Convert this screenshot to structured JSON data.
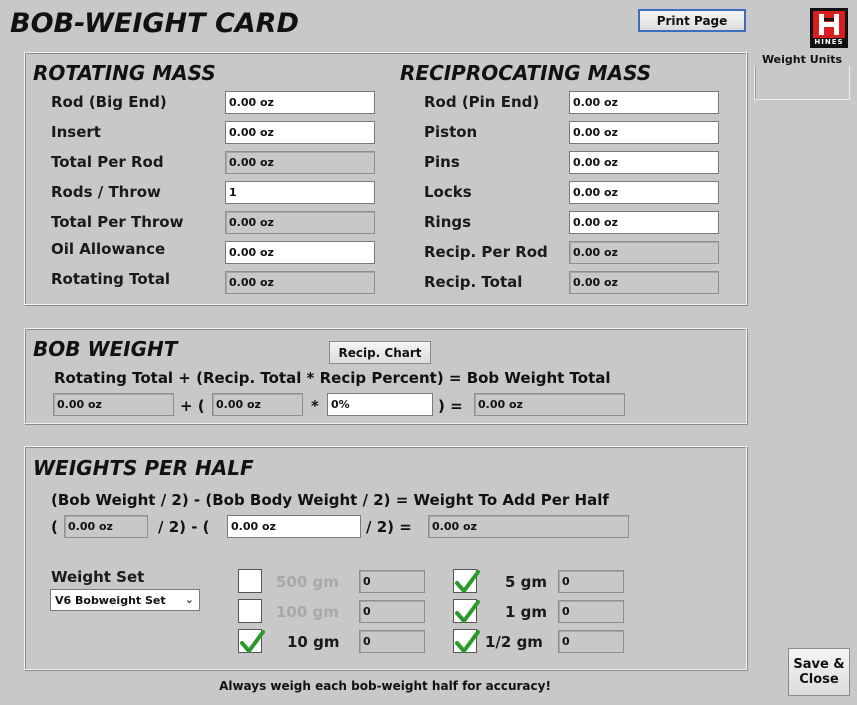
{
  "window": {
    "title": "BOB-WEIGHT CARD"
  },
  "toolbar": {
    "print_label": "Print Page"
  },
  "units": {
    "label": "Weight Units"
  },
  "logo": {
    "text": "HINES"
  },
  "rotating": {
    "title": "ROTATING MASS",
    "rows": [
      {
        "label": "Rod (Big End)",
        "value": "0.00 oz",
        "editable": true
      },
      {
        "label": "Insert",
        "value": "0.00 oz",
        "editable": true
      },
      {
        "label": "Total Per Rod",
        "value": "0.00 oz",
        "editable": false
      },
      {
        "label": "Rods / Throw",
        "value": "1",
        "editable": true
      },
      {
        "label": "Total Per Throw",
        "value": "0.00 oz",
        "editable": false
      },
      {
        "label": "Oil Allowance",
        "value": "0.00 oz",
        "editable": true
      },
      {
        "label": "Rotating Total",
        "value": "0.00 oz",
        "editable": false
      }
    ]
  },
  "reciprocating": {
    "title": "RECIPROCATING MASS",
    "rows": [
      {
        "label": "Rod (Pin End)",
        "value": "0.00 oz",
        "editable": true
      },
      {
        "label": "Piston",
        "value": "0.00 oz",
        "editable": true
      },
      {
        "label": "Pins",
        "value": "0.00 oz",
        "editable": true
      },
      {
        "label": "Locks",
        "value": "0.00 oz",
        "editable": true
      },
      {
        "label": "Rings",
        "value": "0.00 oz",
        "editable": true
      },
      {
        "label": "Recip. Per Rod",
        "value": "0.00 oz",
        "editable": false
      },
      {
        "label": "Recip. Total",
        "value": "0.00 oz",
        "editable": false
      }
    ]
  },
  "bob": {
    "title": "BOB WEIGHT",
    "chart_button": "Recip. Chart",
    "formula": "Rotating Total + (Recip. Total * Recip Percent) = Bob Weight Total",
    "rotating_total": "0.00 oz",
    "op_plus": "+ (",
    "recip_total": "0.00 oz",
    "op_times": "*",
    "recip_percent": "0%",
    "op_equals": ") =",
    "total": "0.00 oz"
  },
  "half": {
    "title": "WEIGHTS PER HALF",
    "formula": "(Bob Weight / 2) - (Bob Body Weight / 2) = Weight To Add Per Half",
    "op_open": "(",
    "bob_weight": "0.00 oz",
    "op_mid": "/ 2) - (",
    "body_weight": "0.00 oz",
    "op_end": "/ 2) =",
    "result": "0.00 oz"
  },
  "weight_set": {
    "label": "Weight Set",
    "selected": "V6 Bobweight Set",
    "items": [
      {
        "label": "500 gm",
        "checked": false,
        "enabled": false,
        "count": "0"
      },
      {
        "label": "100 gm",
        "checked": false,
        "enabled": false,
        "count": "0"
      },
      {
        "label": "10 gm",
        "checked": true,
        "enabled": true,
        "count": "0"
      },
      {
        "label": "5 gm",
        "checked": true,
        "enabled": true,
        "count": "0"
      },
      {
        "label": "1 gm",
        "checked": true,
        "enabled": true,
        "count": "0"
      },
      {
        "label": "1/2 gm",
        "checked": true,
        "enabled": true,
        "count": "0"
      }
    ]
  },
  "footer": {
    "note": "Always weigh each bob-weight half for accuracy!"
  },
  "save_close": {
    "line1": "Save &",
    "line2": "Close"
  },
  "colors": {
    "background": "#c8c8c8",
    "check": "#2a9a2a",
    "logo_red": "#d81e1e",
    "print_border": "#3a6fc0"
  }
}
